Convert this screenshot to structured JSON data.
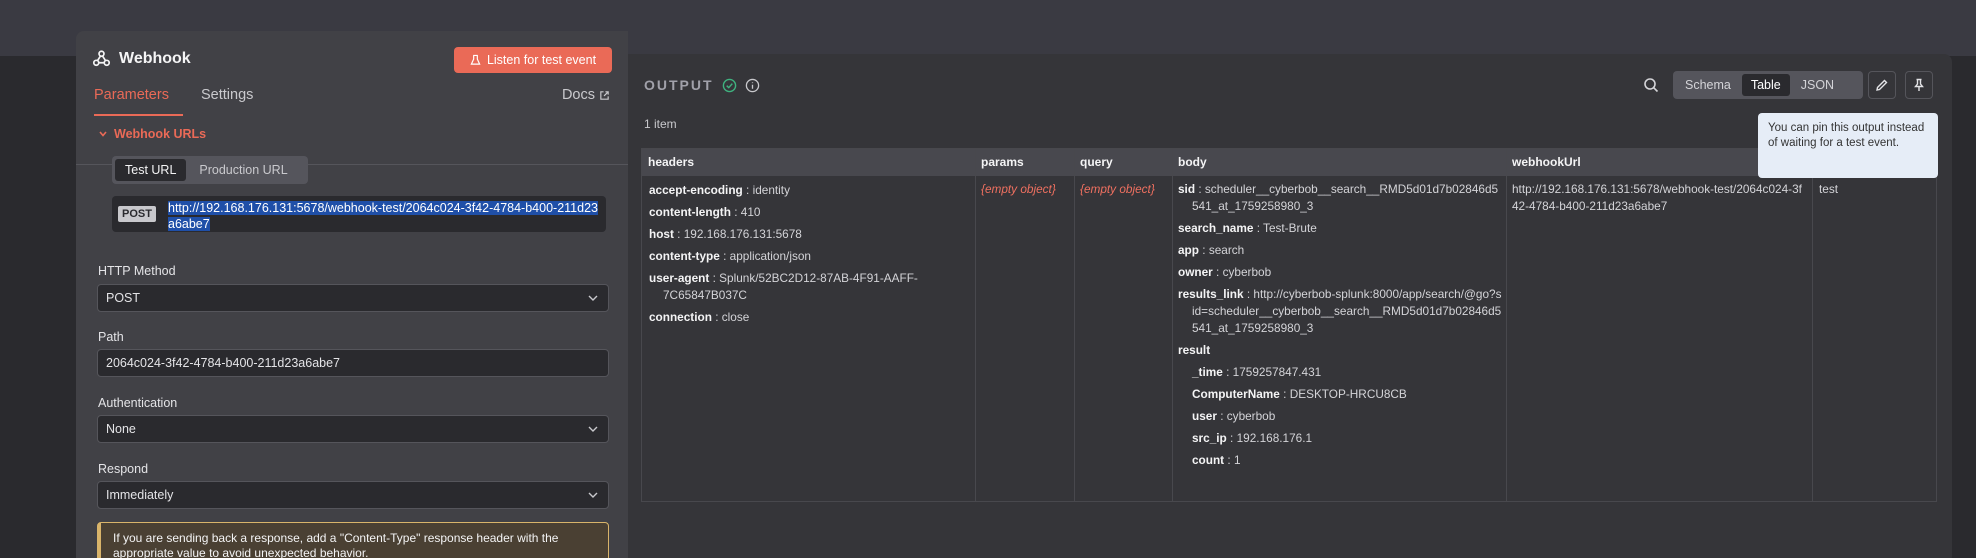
{
  "node": {
    "title": "Webhook",
    "listen_button": "Listen for test event",
    "tabs": [
      "Parameters",
      "Settings"
    ],
    "docs_label": "Docs",
    "section_title": "Webhook URLs",
    "url_tabs": [
      "Test URL",
      "Production URL"
    ],
    "method_badge": "POST",
    "url": "http://192.168.176.131:5678/webhook-test/2064c024-3f42-4784-b400-211d23a6abe7",
    "http_method_label": "HTTP Method",
    "http_method_value": "POST",
    "path_label": "Path",
    "path_value": "2064c024-3f42-4784-b400-211d23a6abe7",
    "auth_label": "Authentication",
    "auth_value": "None",
    "respond_label": "Respond",
    "respond_value": "Immediately",
    "notice": "If you are sending back a response, add a \"Content-Type\" response header with the appropriate value to avoid unexpected behavior."
  },
  "output": {
    "title": "OUTPUT",
    "views": [
      "Schema",
      "Table",
      "JSON"
    ],
    "active_view": "Table",
    "items_count": "1 item",
    "tooltip": "You can pin this output instead of waiting for a test event.",
    "columns": [
      "headers",
      "params",
      "query",
      "body",
      "webhookUrl",
      ""
    ],
    "headers": [
      {
        "k": "accept-encoding",
        "v": "identity"
      },
      {
        "k": "content-length",
        "v": "410"
      },
      {
        "k": "host",
        "v": "192.168.176.131:5678"
      },
      {
        "k": "content-type",
        "v": "application/json"
      },
      {
        "k": "user-agent",
        "v": "Splunk/52BC2D12-87AB-4F91-AAFF-7C65847B037C"
      },
      {
        "k": "connection",
        "v": "close"
      }
    ],
    "params": "{empty object}",
    "query": "{empty object}",
    "body": {
      "sid": "scheduler__cyberbob__search__RMD5d01d7b02846d5541_at_1759258980_3",
      "search_name": "Test-Brute",
      "app": "search",
      "owner": "cyberbob",
      "results_link": "http://cyberbob-splunk:8000/app/search/@go?sid=scheduler__cyberbob__search__RMD5d01d7b02846d5541_at_1759258980_3",
      "result_label": "result",
      "result": [
        {
          "k": "_time",
          "v": "1759257847.431"
        },
        {
          "k": "ComputerName",
          "v": "DESKTOP-HRCU8CB"
        },
        {
          "k": "user",
          "v": "cyberbob"
        },
        {
          "k": "src_ip",
          "v": "192.168.176.1"
        },
        {
          "k": "count",
          "v": "1"
        }
      ]
    },
    "webhookUrl": "http://192.168.176.131:5678/webhook-test/2064c024-3f42-4784-b400-211d23a6abe7",
    "last_col_value": "test"
  }
}
